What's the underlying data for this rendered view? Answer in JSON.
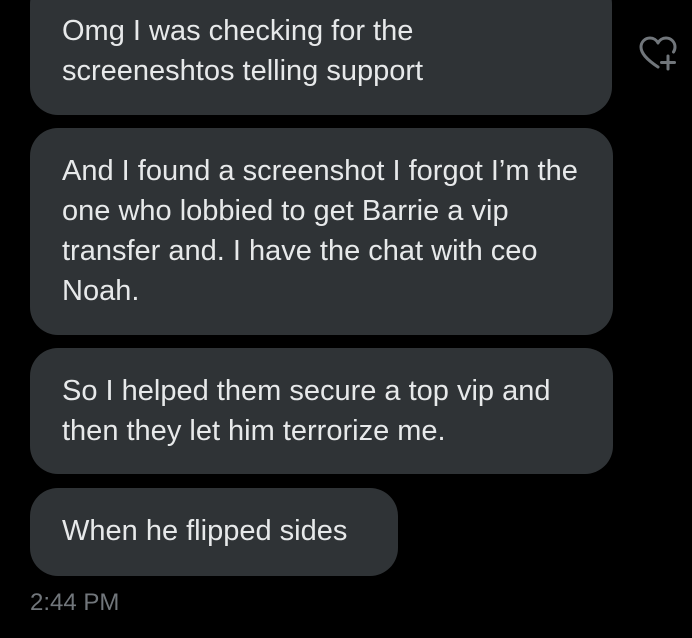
{
  "messages": [
    {
      "text": "Omg I was checking for the screeneshtos telling support"
    },
    {
      "text": "And I found a screenshot I forgot I’m the one who lobbied to get Barrie a vip transfer and. I have the chat with ceo Noah."
    },
    {
      "text": "So I helped them secure a top vip and then they let him terrorize me."
    },
    {
      "text": "When he flipped sides"
    }
  ],
  "timestamp": "2:44 PM",
  "react_button": {
    "icon": "heart-plus-icon"
  },
  "colors": {
    "background": "#000000",
    "bubble": "#2f3336",
    "text": "#e7e9ea",
    "timestamp": "#71767b"
  }
}
